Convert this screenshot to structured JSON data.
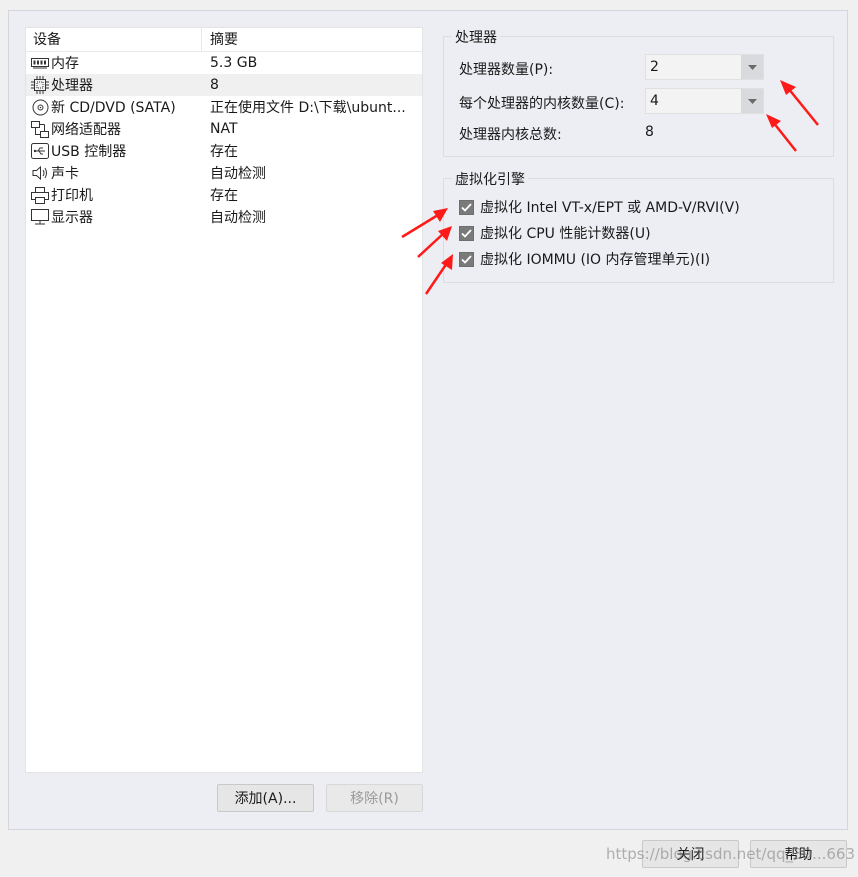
{
  "device_list": {
    "col_device": "设备",
    "col_summary": "摘要",
    "rows": [
      {
        "icon": "memory-icon",
        "device": "内存",
        "summary": "5.3 GB"
      },
      {
        "icon": "processor-icon",
        "device": "处理器",
        "summary": "8"
      },
      {
        "icon": "cd-dvd-icon",
        "device": "新 CD/DVD (SATA)",
        "summary": "正在使用文件 D:\\下载\\ubunt..."
      },
      {
        "icon": "network-adapter-icon",
        "device": "网络适配器",
        "summary": "NAT"
      },
      {
        "icon": "usb-icon",
        "device": "USB 控制器",
        "summary": "存在"
      },
      {
        "icon": "speaker-icon",
        "device": "声卡",
        "summary": "自动检测"
      },
      {
        "icon": "printer-icon",
        "device": "打印机",
        "summary": "存在"
      },
      {
        "icon": "monitor-icon",
        "device": "显示器",
        "summary": "自动检测"
      }
    ]
  },
  "buttons": {
    "add": "添加(A)...",
    "remove": "移除(R)",
    "close": "关闭",
    "help": "帮助"
  },
  "processor_group": {
    "title": "处理器",
    "num_processors_label": "处理器数量(P):",
    "num_processors_value": "2",
    "cores_per_processor_label": "每个处理器的内核数量(C):",
    "cores_per_processor_value": "4",
    "total_cores_label": "处理器内核总数:",
    "total_cores_value": "8"
  },
  "virtualization_group": {
    "title": "虚拟化引擎",
    "options": [
      {
        "label": "虚拟化 Intel VT-x/EPT 或 AMD-V/RVI(V)",
        "checked": true
      },
      {
        "label": "虚拟化 CPU 性能计数器(U)",
        "checked": true
      },
      {
        "label": "虚拟化 IOMMU (IO 内存管理单元)(I)",
        "checked": true
      }
    ]
  },
  "watermark": "https://blog.csdn.net/qq_39...663",
  "colors": {
    "annotation_arrow": "#ff1a1a",
    "checkbox": "#7a7a7a"
  }
}
